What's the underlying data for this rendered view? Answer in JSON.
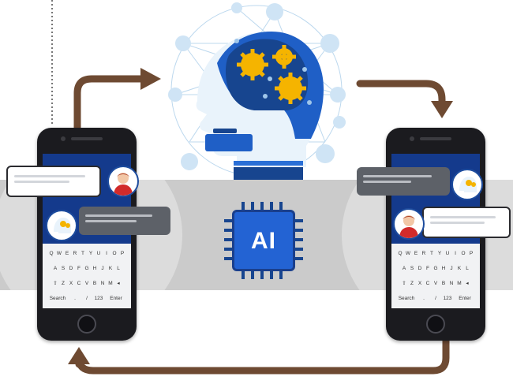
{
  "ai_chip": {
    "label": "AI"
  },
  "keyboard": {
    "row1": [
      "Q",
      "W",
      "E",
      "R",
      "T",
      "Y",
      "U",
      "I",
      "O",
      "P"
    ],
    "row2": [
      "A",
      "S",
      "D",
      "F",
      "G",
      "H",
      "J",
      "K",
      "L"
    ],
    "row3": [
      "⇧",
      "Z",
      "X",
      "C",
      "V",
      "B",
      "N",
      "M",
      "◂"
    ],
    "row4": [
      "Search",
      ".",
      "/",
      "123",
      "Enter"
    ]
  },
  "icons": {
    "left_person": "woman-avatar-icon",
    "left_bot": "robot-head-avatar-icon",
    "right_person": "woman-avatar-icon",
    "right_bot": "robot-head-avatar-icon",
    "center": "brain-gears-head-icon"
  },
  "colors": {
    "brand_blue": "#2363d3",
    "dark_blue": "#143a8c",
    "arrow_brown": "#6e4a32",
    "band_gray": "#c9c9c9",
    "gear_yellow": "#f5b400"
  }
}
